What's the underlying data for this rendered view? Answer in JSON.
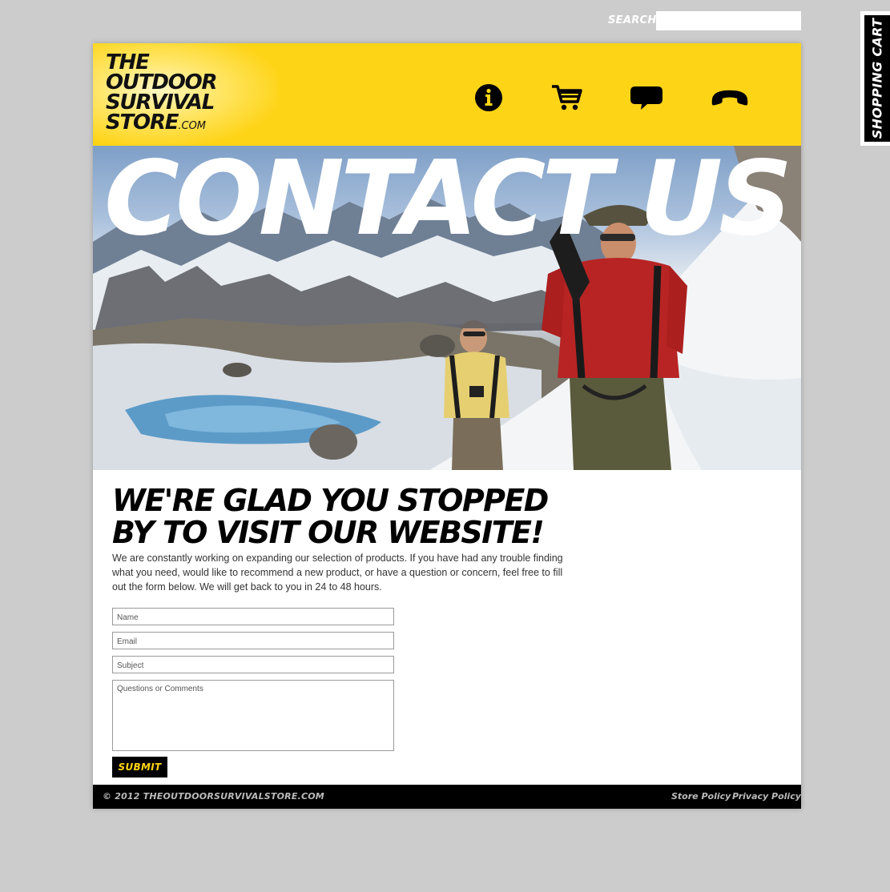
{
  "search": {
    "label": "SEARCH",
    "value": ""
  },
  "cart_tab": {
    "label": "SHOPPING CART"
  },
  "logo": {
    "line1": "THE",
    "line2": "OUTDOOR",
    "line3": "SURVIVAL",
    "line4": "STORE",
    "suffix": ".COM"
  },
  "nav": {
    "icons": [
      "info-icon",
      "shopping-cart-icon",
      "speech-bubble-icon",
      "phone-icon"
    ]
  },
  "hero": {
    "title": "CONTACT US"
  },
  "content": {
    "headline_line1": "WE'RE GLAD YOU STOPPED",
    "headline_line2": "BY TO VISIT OUR WEBSITE!",
    "intro": "We are constantly working on expanding our selection of products. If you have had any trouble finding what you need, would like to recommend a new product, or have a question or concern, feel free to fill out the form below.  We will get back to you in 24 to 48 hours."
  },
  "form": {
    "name_placeholder": "Name",
    "email_placeholder": "Email",
    "subject_placeholder": "Subject",
    "comments_placeholder": "Questions or Comments",
    "submit_label": "SUBMIT"
  },
  "footer": {
    "copyright": "© 2012 THEOUTDOORSURVIVALSTORE.COM",
    "store_policy": "Store Policy",
    "privacy_policy": "Privacy Policy"
  },
  "colors": {
    "brand_yellow": "#fed417",
    "black": "#000000",
    "page_bg": "#cccccc"
  }
}
